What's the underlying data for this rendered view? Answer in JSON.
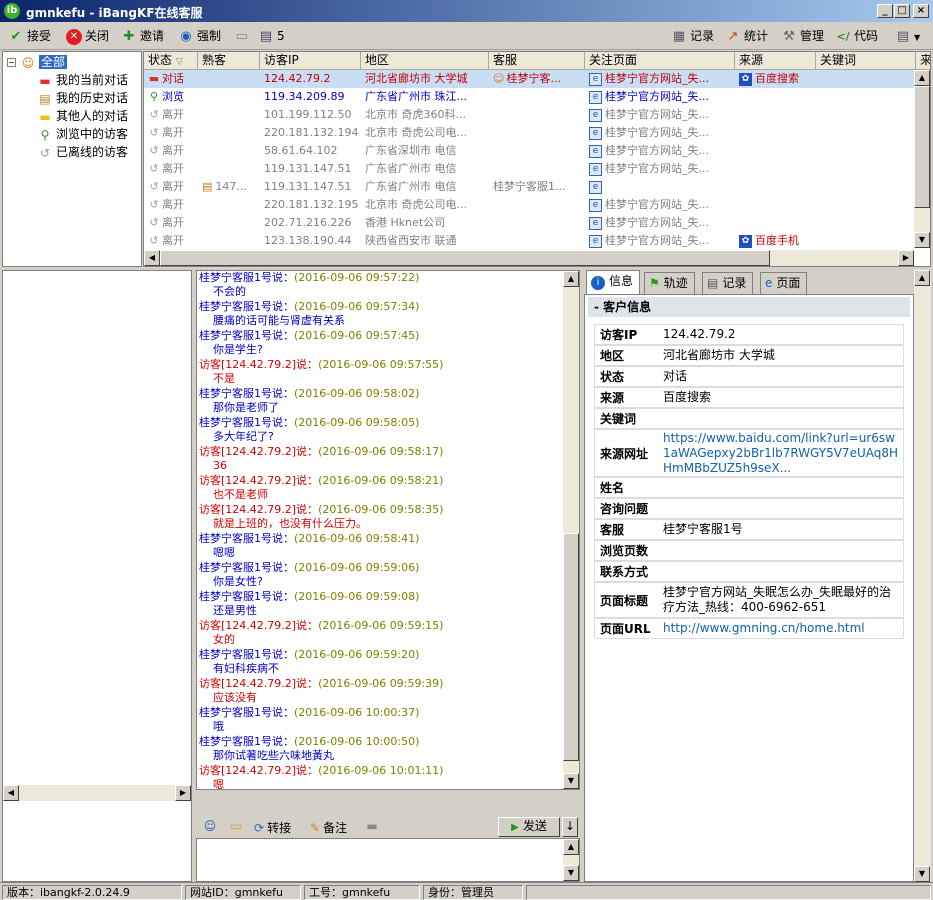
{
  "window": {
    "title": "gmnkefu - iBangKF在线客服",
    "logo_text": "ib",
    "min": "_",
    "max": "□",
    "close": "×"
  },
  "toolbar": {
    "accept": "接受",
    "close": "关闭",
    "invite": "邀请",
    "force": "强制",
    "badge_count": "5",
    "records": "记录",
    "stats": "统计",
    "manage": "管理",
    "code": "代码"
  },
  "tree": {
    "root": "全部",
    "items": [
      "我的当前对话",
      "我的历史对话",
      "其他人的对话",
      "浏览中的访客",
      "已离线的访客"
    ]
  },
  "visitor_table": {
    "headers": [
      "状态",
      "熟客",
      "访客IP",
      "地区",
      "客服",
      "关注页面",
      "来源",
      "关键词",
      "来"
    ],
    "rows": [
      {
        "status": "对话",
        "regular": "",
        "ip": "124.42.79.2",
        "region": "河北省廊坊市 大学城",
        "agent": "桂梦宁客...",
        "page": "桂梦宁官方网站_失...",
        "source": "百度搜索"
      },
      {
        "status": "浏览",
        "regular": "",
        "ip": "119.34.209.89",
        "region": "广东省广州市 珠江...",
        "agent": "",
        "page": "桂梦宁官方网站_失...",
        "source": ""
      },
      {
        "status": "离开",
        "regular": "",
        "ip": "101.199.112.50",
        "region": "北京市 奇虎360科...",
        "agent": "",
        "page": "桂梦宁官方网站_失...",
        "source": ""
      },
      {
        "status": "离开",
        "regular": "",
        "ip": "220.181.132.194",
        "region": "北京市 奇虎公司电...",
        "agent": "",
        "page": "桂梦宁官方网站_失...",
        "source": ""
      },
      {
        "status": "离开",
        "regular": "",
        "ip": "58.61.64.102",
        "region": "广东省深圳市 电信",
        "agent": "",
        "page": "桂梦宁官方网站_失...",
        "source": ""
      },
      {
        "status": "离开",
        "regular": "",
        "ip": "119.131.147.51",
        "region": "广东省广州市 电信",
        "agent": "",
        "page": "桂梦宁官方网站_失...",
        "source": ""
      },
      {
        "status": "离开",
        "regular": "147...",
        "ip": "119.131.147.51",
        "region": "广东省广州市 电信",
        "agent": "桂梦宁客服1...",
        "page": "",
        "source": ""
      },
      {
        "status": "离开",
        "regular": "",
        "ip": "220.181.132.195",
        "region": "北京市 奇虎公司电...",
        "agent": "",
        "page": "桂梦宁官方网站_失...",
        "source": ""
      },
      {
        "status": "离开",
        "regular": "",
        "ip": "202.71.216.226",
        "region": "香港 Hknet公司",
        "agent": "",
        "page": "桂梦宁官方网站_失...",
        "source": ""
      },
      {
        "status": "离开",
        "regular": "",
        "ip": "123.138.190.44",
        "region": "陕西省西安市 联通",
        "agent": "",
        "page": "桂梦宁官方网站_失...",
        "source": "百度手机"
      }
    ]
  },
  "chat": {
    "messages": [
      {
        "who": "桂梦宁客服1号说：",
        "role": "agent",
        "time": "(2016-09-06 09:57:22)",
        "text": "不会的"
      },
      {
        "who": "桂梦宁客服1号说：",
        "role": "agent",
        "time": "(2016-09-06 09:57:34)",
        "text": "腰痛的话可能与肾虚有关系"
      },
      {
        "who": "桂梦宁客服1号说：",
        "role": "agent",
        "time": "(2016-09-06 09:57:45)",
        "text": "你是学生?"
      },
      {
        "who": "访客[124.42.79.2]说：",
        "role": "visitor",
        "time": "(2016-09-06 09:57:55)",
        "text": "不是"
      },
      {
        "who": "桂梦宁客服1号说：",
        "role": "agent",
        "time": "(2016-09-06 09:58:02)",
        "text": "那你是老师了"
      },
      {
        "who": "桂梦宁客服1号说：",
        "role": "agent",
        "time": "(2016-09-06 09:58:05)",
        "text": "多大年纪了?"
      },
      {
        "who": "访客[124.42.79.2]说：",
        "role": "visitor",
        "time": "(2016-09-06 09:58:17)",
        "text": "36"
      },
      {
        "who": "访客[124.42.79.2]说：",
        "role": "visitor",
        "time": "(2016-09-06 09:58:21)",
        "text": "也不是老师"
      },
      {
        "who": "访客[124.42.79.2]说：",
        "role": "visitor",
        "time": "(2016-09-06 09:58:35)",
        "text": "就是上班的，也没有什么压力。"
      },
      {
        "who": "桂梦宁客服1号说：",
        "role": "agent",
        "time": "(2016-09-06 09:58:41)",
        "text": "嗯嗯"
      },
      {
        "who": "桂梦宁客服1号说：",
        "role": "agent",
        "time": "(2016-09-06 09:59:06)",
        "text": "你是女性?"
      },
      {
        "who": "桂梦宁客服1号说：",
        "role": "agent",
        "time": "(2016-09-06 09:59:08)",
        "text": "还是男性"
      },
      {
        "who": "访客[124.42.79.2]说：",
        "role": "visitor",
        "time": "(2016-09-06 09:59:15)",
        "text": "女的"
      },
      {
        "who": "桂梦宁客服1号说：",
        "role": "agent",
        "time": "(2016-09-06 09:59:20)",
        "text": "有妇科疾病不"
      },
      {
        "who": "访客[124.42.79.2]说：",
        "role": "visitor",
        "time": "(2016-09-06 09:59:39)",
        "text": "应该没有"
      },
      {
        "who": "桂梦宁客服1号说：",
        "role": "agent",
        "time": "(2016-09-06 10:00:37)",
        "text": "哦"
      },
      {
        "who": "桂梦宁客服1号说：",
        "role": "agent",
        "time": "(2016-09-06 10:00:50)",
        "text": "那你试著吃些六味地黃丸"
      },
      {
        "who": "访客[124.42.79.2]说：",
        "role": "visitor",
        "time": "(2016-09-06 10:01:11)",
        "text": "嗯"
      }
    ],
    "transfer": "转接",
    "note": "备注",
    "send": "发送"
  },
  "right": {
    "tabs": [
      "信息",
      "轨迹",
      "记录",
      "页面"
    ],
    "section_title": "- 客户信息",
    "rows": [
      {
        "k": "访客IP",
        "v": "124.42.79.2"
      },
      {
        "k": "地区",
        "v": "河北省廊坊市 大学城"
      },
      {
        "k": "状态",
        "v": "对话"
      },
      {
        "k": "来源",
        "v": "百度搜索"
      },
      {
        "k": "关键词",
        "v": ""
      },
      {
        "k": "来源网址",
        "v": "https://www.baidu.com/link?url=ur6sw1aWAGepxy2bBr1lb7RWGY5V7eUAq8HHmMBbZUZ5h9seX..."
      },
      {
        "k": "姓名",
        "v": ""
      },
      {
        "k": "咨询问题",
        "v": ""
      },
      {
        "k": "客服",
        "v": "桂梦宁客服1号"
      },
      {
        "k": "浏览页数",
        "v": ""
      },
      {
        "k": "联系方式",
        "v": ""
      },
      {
        "k": "页面标题",
        "v": "桂梦宁官方网站_失眠怎么办_失眠最好的治疗方法_热线：400-6962-651"
      },
      {
        "k": "页面URL",
        "v": "http://www.gmning.cn/home.html"
      }
    ]
  },
  "status": {
    "version": "版本：ibangkf-2.0.24.9",
    "site": "网站ID：gmnkefu",
    "job": "工号：gmnkefu",
    "role": "身份：管理员"
  }
}
